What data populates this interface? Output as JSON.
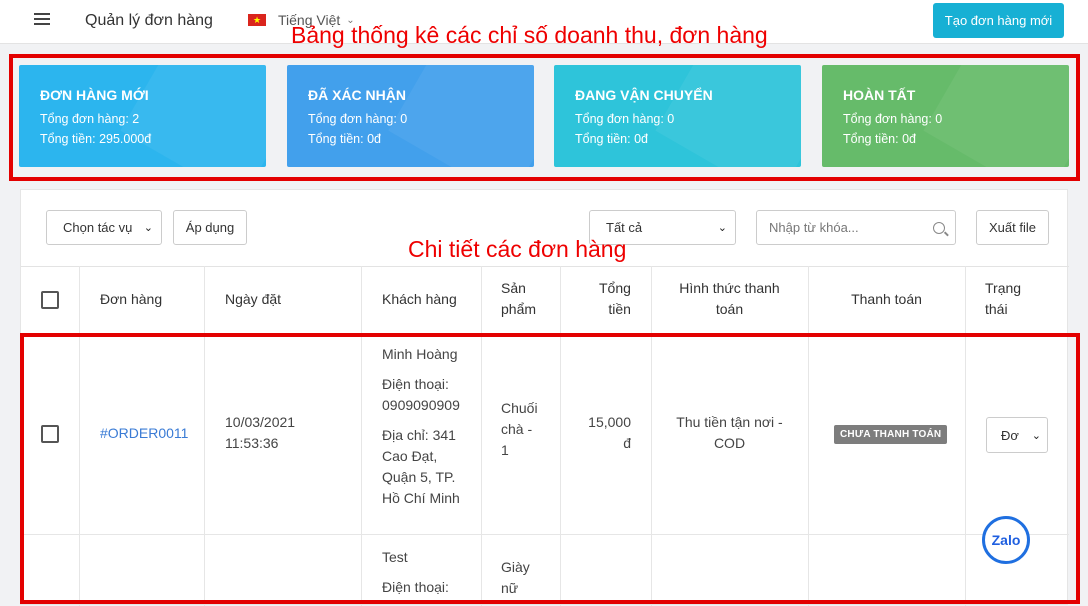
{
  "header": {
    "title": "Quản lý đơn hàng",
    "language": "Tiếng Việt",
    "create_button": "Tạo đơn hàng mới"
  },
  "annotations": {
    "stats": "Bảng thống kê các chỉ số doanh thu, đơn hàng",
    "details": "Chi tiết các đơn hàng"
  },
  "cards": [
    {
      "title": "ĐƠN HÀNG MỚI",
      "count": "Tổng đơn hàng: 2",
      "total": "Tổng tiền: 295.000đ",
      "color": "#2cb5ee"
    },
    {
      "title": "ĐÃ XÁC NHẬN",
      "count": "Tổng đơn hàng: 0",
      "total": "Tổng tiền: 0đ",
      "color": "#42a0ec"
    },
    {
      "title": "ĐANG VẬN CHUYỂN",
      "count": "Tổng đơn hàng: 0",
      "total": "Tổng tiền: 0đ",
      "color": "#2ec4da"
    },
    {
      "title": "HOÀN TẤT",
      "count": "Tổng đơn hàng: 0",
      "total": "Tổng tiền: 0đ",
      "color": "#66bb6a"
    }
  ],
  "toolbar": {
    "bulk_action": "Chọn tác vụ",
    "apply": "Áp dụng",
    "filter": "Tất cả",
    "search_placeholder": "Nhập từ khóa...",
    "export": "Xuất file"
  },
  "table": {
    "headers": {
      "order": "Đơn hàng",
      "date": "Ngày đặt",
      "customer": "Khách hàng",
      "product": [
        "Sản",
        "phẩm"
      ],
      "total": [
        "Tổng",
        "tiền"
      ],
      "method": [
        "Hình thức thanh",
        "toán"
      ],
      "payment": "Thanh toán",
      "status": [
        "Trạng",
        "thái"
      ]
    },
    "rows": [
      {
        "order_id": "#ORDER0011",
        "date": [
          "10/03/2021",
          "11:53:36"
        ],
        "customer_name": "Minh Hoàng",
        "phone": [
          "Điện thoại:",
          "0909090909"
        ],
        "address": [
          "Địa chỉ: 341",
          "Cao Đạt,",
          "Quận 5, TP.",
          "Hồ Chí Minh"
        ],
        "product": [
          "Chuối",
          "chà -",
          "1"
        ],
        "total": [
          "15,000",
          "đ"
        ],
        "method": [
          "Thu tiền tận nơi -",
          "COD"
        ],
        "payment_status": "CHƯA THANH TOÁN",
        "status": "Đơ"
      },
      {
        "customer_name": "Test",
        "phone": [
          "Điện thoại:"
        ],
        "product": [
          "Giày",
          "nữ"
        ]
      }
    ]
  },
  "zalo": "Zalo"
}
